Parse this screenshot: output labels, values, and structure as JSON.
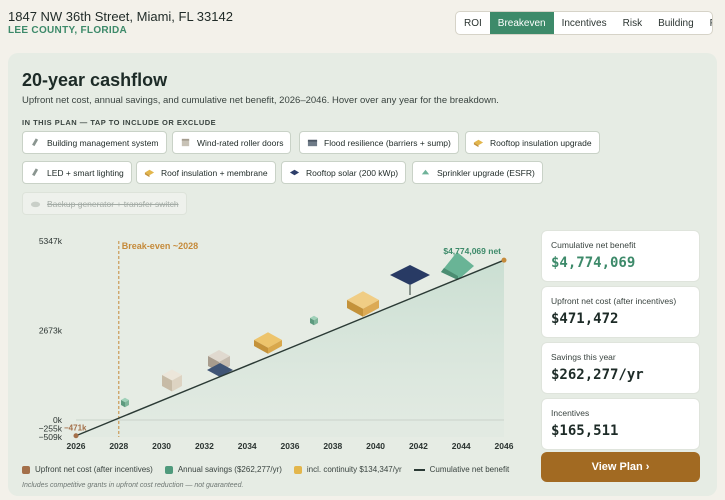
{
  "header": {
    "address": "1847 NW 36th Street, Miami, FL 33142",
    "county": "LEE COUNTY, FLORIDA",
    "tabs": [
      {
        "label": "ROI",
        "active": false
      },
      {
        "label": "Breakeven",
        "active": true
      },
      {
        "label": "Incentives",
        "active": false
      },
      {
        "label": "Risk",
        "active": false
      },
      {
        "label": "Building",
        "active": false
      },
      {
        "label": "Plan",
        "active": false
      }
    ]
  },
  "main": {
    "title": "20-year cashflow",
    "subtitle": "Upfront net cost, annual savings, and cumulative net benefit, 2026–2046. Hover over any year for the breakdown.",
    "plan_label": "IN THIS PLAN — TAP TO INCLUDE OR EXCLUDE",
    "chips": [
      {
        "label": "Building management system",
        "icon": "chip-icon",
        "included": true
      },
      {
        "label": "Wind-rated roller doors",
        "icon": "box-icon",
        "included": true
      },
      {
        "label": "Flood resilience (barriers + sump)",
        "icon": "barrier-icon",
        "included": true
      },
      {
        "label": "Rooftop insulation upgrade",
        "icon": "insulation-icon",
        "included": true
      },
      {
        "label": "LED + smart lighting",
        "icon": "bulb-icon",
        "included": true
      },
      {
        "label": "Roof insulation + membrane",
        "icon": "membrane-icon",
        "included": true
      },
      {
        "label": "Rooftop solar (200 kWp)",
        "icon": "solar-panel-icon",
        "included": true
      },
      {
        "label": "Sprinkler upgrade (ESFR)",
        "icon": "sprinkler-icon",
        "included": true
      },
      {
        "label": "Backup generator + transfer switch",
        "icon": "generator-icon",
        "included": false
      }
    ]
  },
  "chart_data": {
    "type": "line",
    "x_ticks": [
      "2026",
      "2028",
      "2030",
      "2032",
      "2034",
      "2036",
      "2038",
      "2040",
      "2042",
      "2044",
      "2046"
    ],
    "y_ticks": [
      "5347k",
      "2673k",
      "0k",
      "−255k",
      "−509k"
    ],
    "ylim": [
      -509,
      5347
    ],
    "xlim": [
      2026,
      2046
    ],
    "breakeven_year": 2028,
    "breakeven_label": "Break-even ~2028",
    "start_label": "−471k",
    "end_label": "$4,774,069 net",
    "series": [
      {
        "name": "Cumulative net benefit",
        "x": [
          2026,
          2046
        ],
        "y": [
          -471,
          4774
        ]
      }
    ],
    "grid": false
  },
  "legend": [
    {
      "label": "Upfront net cost (after incentives)",
      "color": "#a4704a",
      "kind": "box"
    },
    {
      "label": "Annual savings ($262,277/yr)",
      "color": "#4f9a7c",
      "kind": "box"
    },
    {
      "label": "incl. continuity $134,347/yr",
      "color": "#e3b64c",
      "kind": "box"
    },
    {
      "label": "Cumulative net benefit",
      "color": "#2b3a35",
      "kind": "line"
    }
  ],
  "note": "Includes competitive grants in upfront cost reduction — not guaranteed.",
  "metrics": [
    {
      "label": "Cumulative net benefit",
      "value": "$4,774,069",
      "accent": true
    },
    {
      "label": "Upfront net cost (after incentives)",
      "value": "$471,472",
      "accent": false
    },
    {
      "label": "Savings this year",
      "value": "$262,277/yr",
      "accent": false
    },
    {
      "label": "Incentives",
      "value": "$165,511",
      "accent": false
    }
  ],
  "cta": {
    "label": "View Plan ›"
  },
  "colors": {
    "accent": "#3d8a6a",
    "cta": "#a26a22",
    "breakeven": "#c58a3a"
  }
}
